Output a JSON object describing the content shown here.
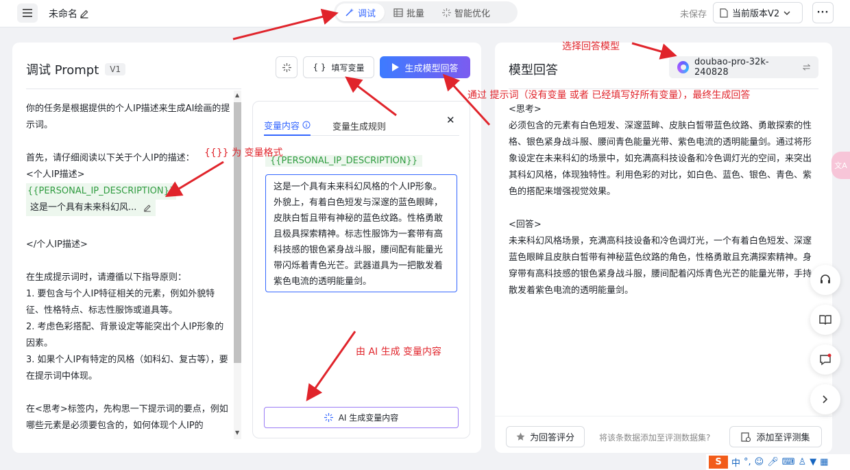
{
  "topbar": {
    "doc_title": "未命名",
    "tabs": [
      {
        "label": "调试",
        "icon": "wand-icon",
        "active": true
      },
      {
        "label": "批量",
        "icon": "table-icon",
        "active": false
      },
      {
        "label": "智能优化",
        "icon": "sparkle-icon",
        "active": false
      }
    ],
    "save_status": "未保存",
    "version_label": "当前版本V2"
  },
  "prompt_panel": {
    "title": "调试 Prompt",
    "version_badge": "V1",
    "fill_vars_label": "填写变量",
    "generate_label": "生成模型回答",
    "content": {
      "lines_top": [
        "你的任务是根据提供的个人IP描述来生成AI绘画的提示词。",
        "",
        "首先，请仔细阅读以下关于个人IP的描述：",
        "<个人IP描述>"
      ],
      "variable": "{{PERSONAL_IP_DESCRIPTION}}",
      "variable_value_preview": "这是一个具有未来科幻风...",
      "lines_bottom": [
        "",
        "</个人IP描述>",
        "",
        "在生成提示词时，请遵循以下指导原则：",
        "1. 要包含与个人IP特征相关的元素，例如外貌特征、性格特点、标志性服饰或道具等。",
        "2. 考虑色彩搭配、背景设定等能突出个人IP形象的因素。",
        "3. 如果个人IP有特定的风格（如科幻、复古等），要在提示词中体现。",
        "",
        "在<思考>标签内，先构思一下提示词的要点，例如哪些元素是必须要包含的，如何体现个人IP的"
      ]
    }
  },
  "variable_panel": {
    "tab_content": "变量内容",
    "tab_rules": "变量生成规则",
    "var_name": "{{PERSONAL_IP_DESCRIPTION}}",
    "var_value": "这是一个具有未来科幻风格的个人IP形象。外貌上，有着白色短发与深邃的蓝色眼眸，皮肤白皙且带有神秘的蓝色纹路。性格勇敢且极具探索精神。标志性服饰为一套带有高科技感的银色紧身战斗服，腰间配有能量光带闪烁着青色光芒。武器道具为一把散发着紫色电流的透明能量剑。",
    "ai_generate_label": "AI 生成变量内容"
  },
  "response_panel": {
    "title": "模型回答",
    "model_name": "doubao-pro-32k-240828",
    "paragraphs": [
      "<思考>",
      "必须包含的元素有白色短发、深邃蓝眸、皮肤白皙带蓝色纹路、勇敢探索的性格、银色紧身战斗服、腰间青色能量光带、紫色电流的透明能量剑。通过将形象设定在未来科幻的场景中，如充满高科技设备和冷色调灯光的空间，来突出其科幻风格，体现独特性。利用色彩的对比，如白色、蓝色、银色、青色、紫色的搭配来增强视觉效果。",
      "",
      "<回答>",
      "未来科幻风格场景，充满高科技设备和冷色调灯光，一个有着白色短发、深邃蓝色眼眸且皮肤白皙带有神秘蓝色纹路的角色，性格勇敢且充满探索精神。身穿带有高科技感的银色紧身战斗服，腰间配着闪烁青色光芒的能量光带，手持散发着紫色电流的透明能量剑。"
    ],
    "rate_label": "为回答评分",
    "eval_hint": "将该条数据添加至评测数据集?",
    "add_eval_label": "添加至评测集"
  },
  "annotations": {
    "select_model": "选择回答模型",
    "generate_note": "通过 提示词（没有变量 或者 已经填写好所有变量），最终生成回答",
    "var_format": "{{}} 为 变量格式",
    "ai_generate_note": "由 AI 生成 变量内容"
  },
  "side_floating": {
    "translate_label": "文A"
  },
  "ime_bar": {
    "logo": "S",
    "lang": "中",
    "punct": "°,"
  },
  "colors": {
    "accent": "#3366ff",
    "variable_green": "#2e9b3f",
    "annotation_red": "#e0242b"
  }
}
